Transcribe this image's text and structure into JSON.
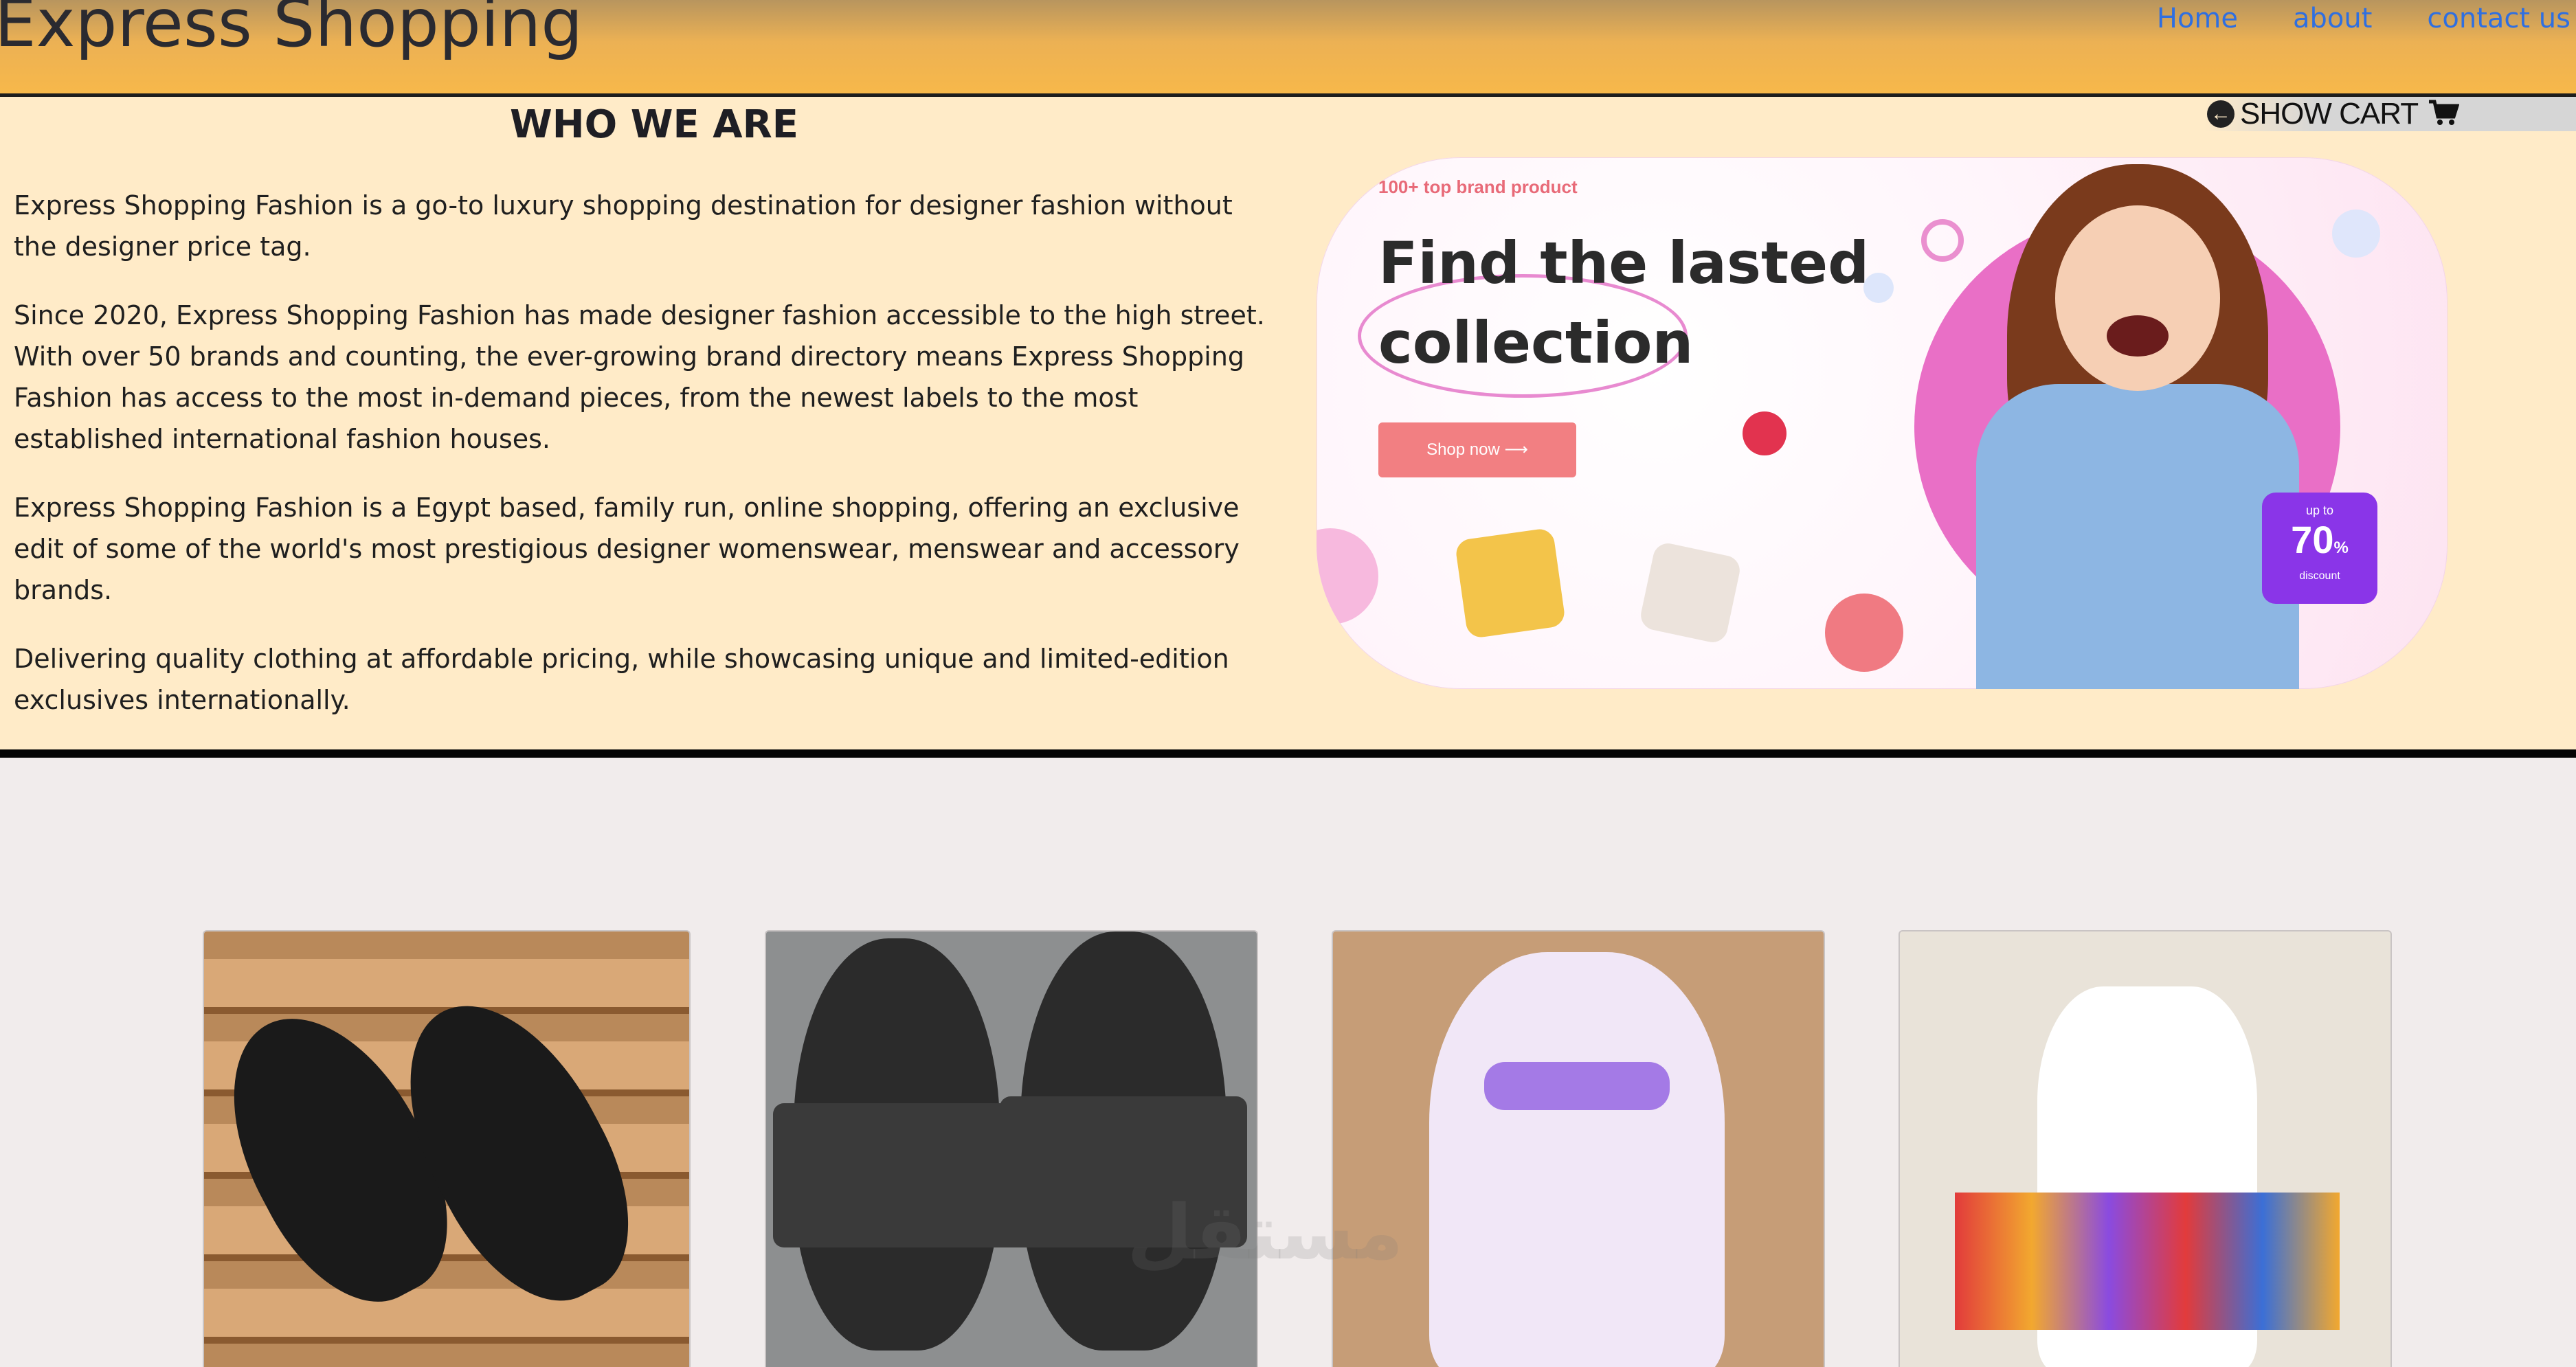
{
  "header": {
    "brand": "Express Shopping",
    "nav": [
      "Home",
      "about",
      "contact us"
    ]
  },
  "about": {
    "heading": "WHO WE ARE",
    "paragraphs": [
      "Express Shopping Fashion is a go-to luxury shopping destination for designer fashion without the designer price tag.",
      "Since 2020, Express Shopping Fashion has made designer fashion accessible to the high street. With over 50 brands and counting, the ever-growing brand directory means Express Shopping Fashion has access to the most in-demand pieces, from the newest labels to the most established international fashion houses.",
      "Express Shopping Fashion is a Egypt based, family run, online shopping, offering an exclusive edit of some of the world's most prestigious designer womenswear, menswear and accessory brands.",
      "Delivering quality clothing at affordable pricing, while showcasing unique and limited-edition exclusives internationally."
    ]
  },
  "cart": {
    "label": "SHOW CART",
    "back_icon": "arrow-circle-left-icon",
    "cart_icon": "shopping-cart-icon"
  },
  "banner": {
    "tag": "100+ top brand product",
    "title_line1": "Find the lasted",
    "title_line2": "collection",
    "button": "Shop now ⟶",
    "badge_upto": "up to",
    "badge_value": "70",
    "badge_unit": "%",
    "badge_label": "discount"
  },
  "products": [
    {
      "name": "black flip-flop sandals"
    },
    {
      "name": "black slide slippers"
    },
    {
      "name": "purple floral dress"
    },
    {
      "name": "white floral dress"
    }
  ],
  "colors": {
    "header_gradient_end": "#f7b84a",
    "about_bg": "#ffebc8",
    "nav_link": "#2f6fe0",
    "banner_button": "#f27f82",
    "badge": "#8a35e8"
  }
}
